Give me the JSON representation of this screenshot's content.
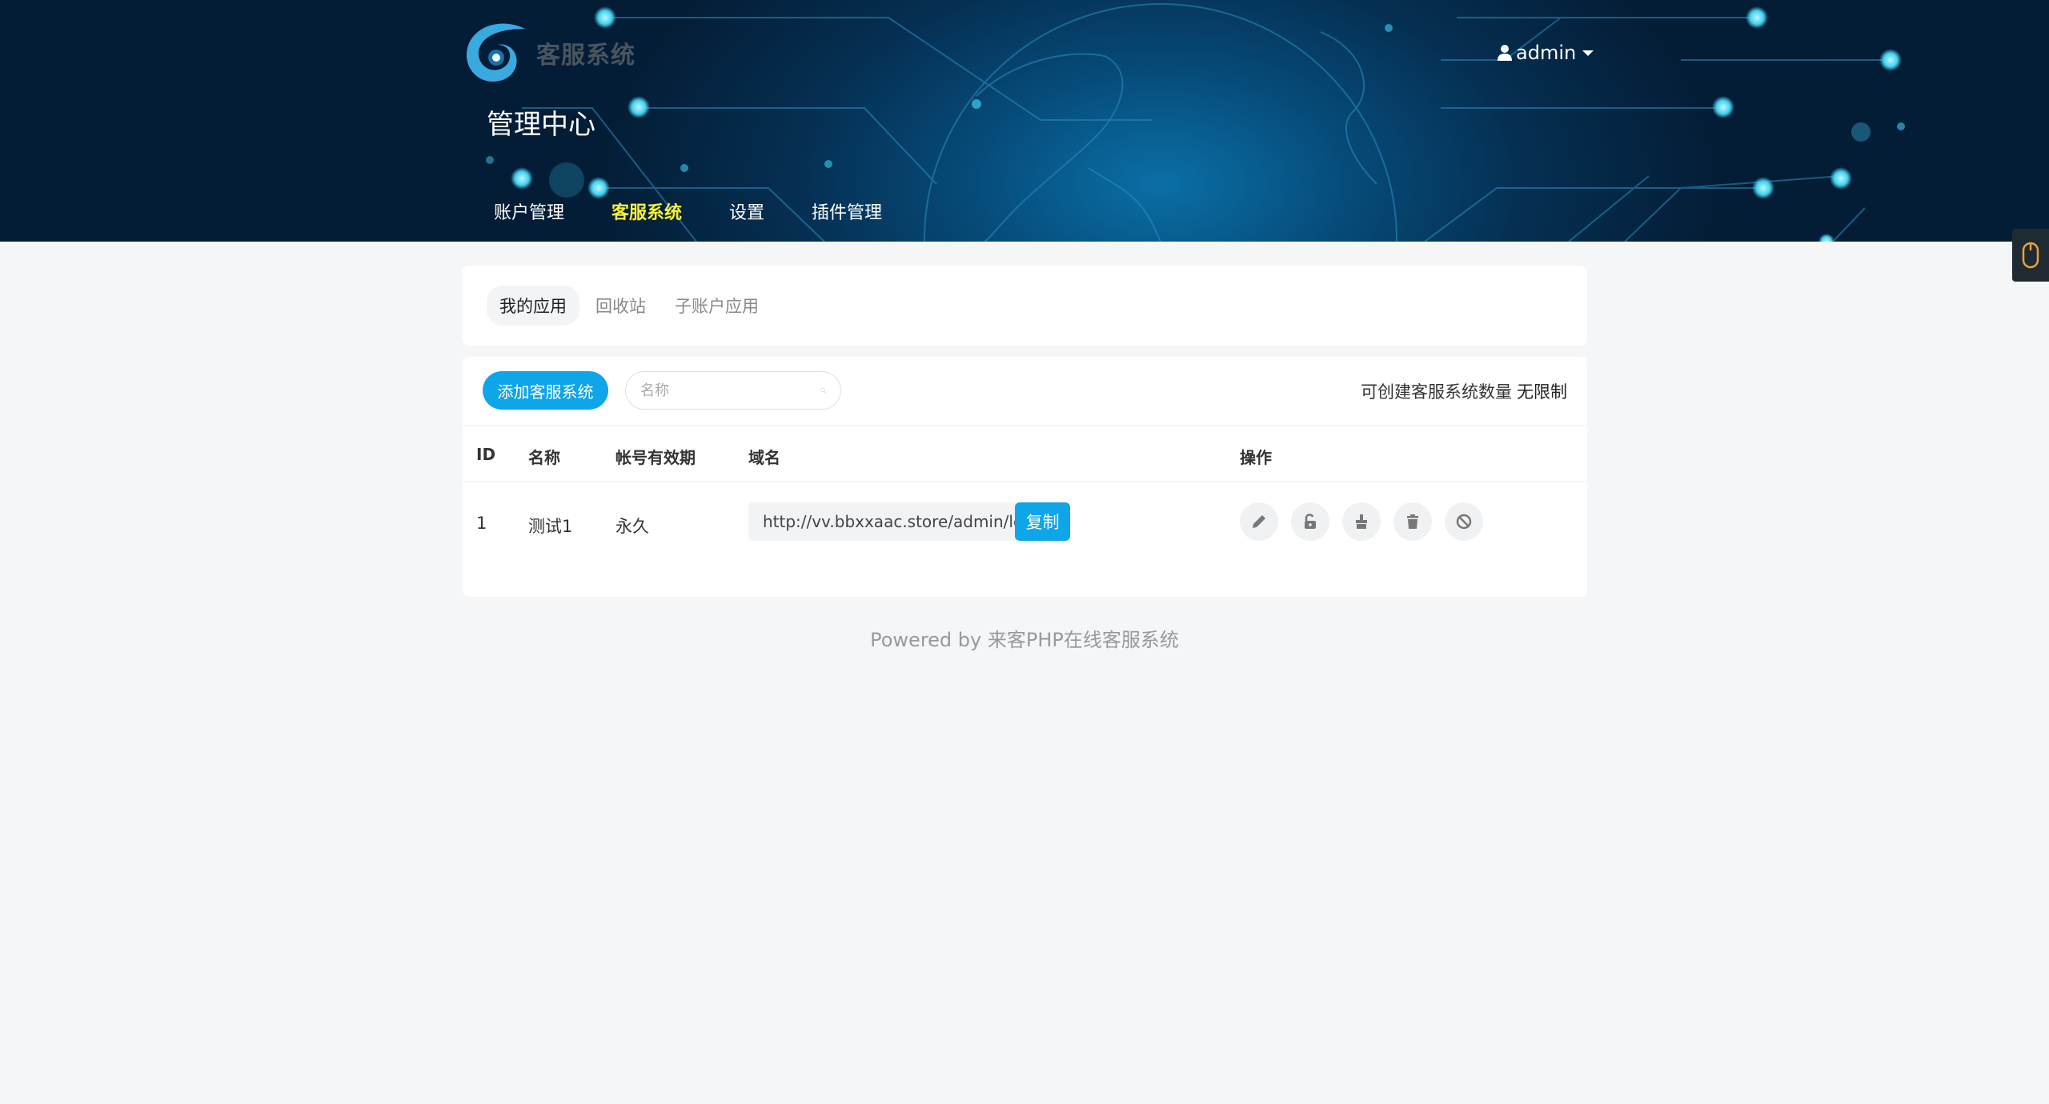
{
  "header": {
    "logo_text": "客服系统",
    "page_title": "管理中心",
    "user": "admin",
    "nav": [
      {
        "label": "账户管理",
        "active": false
      },
      {
        "label": "客服系统",
        "active": true
      },
      {
        "label": "设置",
        "active": false
      },
      {
        "label": "插件管理",
        "active": false
      }
    ]
  },
  "sub_tabs": [
    {
      "label": "我的应用",
      "active": true
    },
    {
      "label": "回收站",
      "active": false
    },
    {
      "label": "子账户应用",
      "active": false
    }
  ],
  "toolbar": {
    "add_label": "添加客服系统",
    "search_placeholder": "名称",
    "quota_label": "可创建客服系统数量",
    "quota_value": "无限制"
  },
  "table": {
    "columns": [
      "ID",
      "名称",
      "帐号有效期",
      "域名",
      "操作"
    ],
    "rows": [
      {
        "id": "1",
        "name": "测试1",
        "expire": "永久",
        "domain": "http://vv.bbxxaac.store/admin/login/index",
        "copy_label": "复制"
      }
    ],
    "actions": [
      "edit-icon",
      "unlock-icon",
      "clean-icon",
      "trash-icon",
      "ban-icon"
    ]
  },
  "footer": "Powered by 来客PHP在线客服系统",
  "colors": {
    "accent": "#0ea5e9",
    "nav_active": "#f7f03a",
    "banner_dark": "#041d36"
  }
}
